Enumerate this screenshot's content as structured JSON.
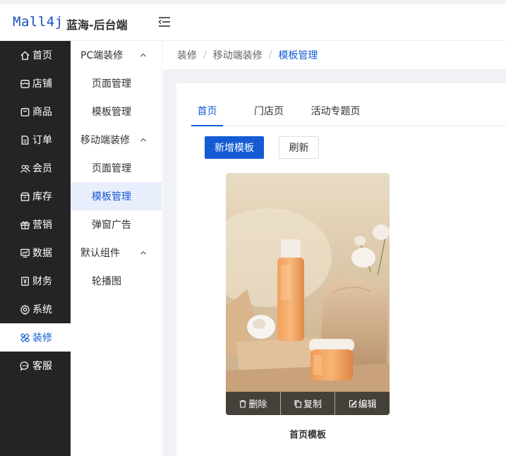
{
  "header": {
    "logo": "Mall4j",
    "app_title": "蓝海-后台端"
  },
  "sidebar": {
    "items": [
      {
        "label": "首页",
        "icon": "home-icon"
      },
      {
        "label": "店铺",
        "icon": "store-icon"
      },
      {
        "label": "商品",
        "icon": "bag-icon"
      },
      {
        "label": "订单",
        "icon": "order-icon"
      },
      {
        "label": "会员",
        "icon": "members-icon"
      },
      {
        "label": "库存",
        "icon": "inventory-icon"
      },
      {
        "label": "营销",
        "icon": "gift-icon"
      },
      {
        "label": "数据",
        "icon": "data-icon"
      },
      {
        "label": "财务",
        "icon": "finance-icon"
      },
      {
        "label": "系统",
        "icon": "gear-icon"
      },
      {
        "label": "装修",
        "icon": "decor-icon",
        "active": true
      },
      {
        "label": "客服",
        "icon": "chat-icon"
      }
    ]
  },
  "submenu": {
    "groups": [
      {
        "label": "PC端装修",
        "items": [
          "页面管理",
          "模板管理"
        ]
      },
      {
        "label": "移动端装修",
        "items": [
          "页面管理",
          "模板管理",
          "弹窗广告"
        ]
      },
      {
        "label": "默认组件",
        "items": [
          "轮播图"
        ]
      }
    ],
    "active_item": "模板管理"
  },
  "breadcrumb": {
    "items": [
      "装修",
      "移动端装修",
      "模板管理"
    ]
  },
  "tabs": {
    "items": [
      "首页",
      "门店页",
      "活动专题页"
    ],
    "active": "首页"
  },
  "toolbar": {
    "add_label": "新增模板",
    "refresh_label": "刷新"
  },
  "template_card": {
    "title": "首页模板",
    "delete_label": "删除",
    "copy_label": "复制",
    "edit_label": "编辑"
  },
  "colors": {
    "accent": "#155bd4",
    "sidebar_bg": "#242424",
    "page_bg": "#f0f2f5"
  }
}
